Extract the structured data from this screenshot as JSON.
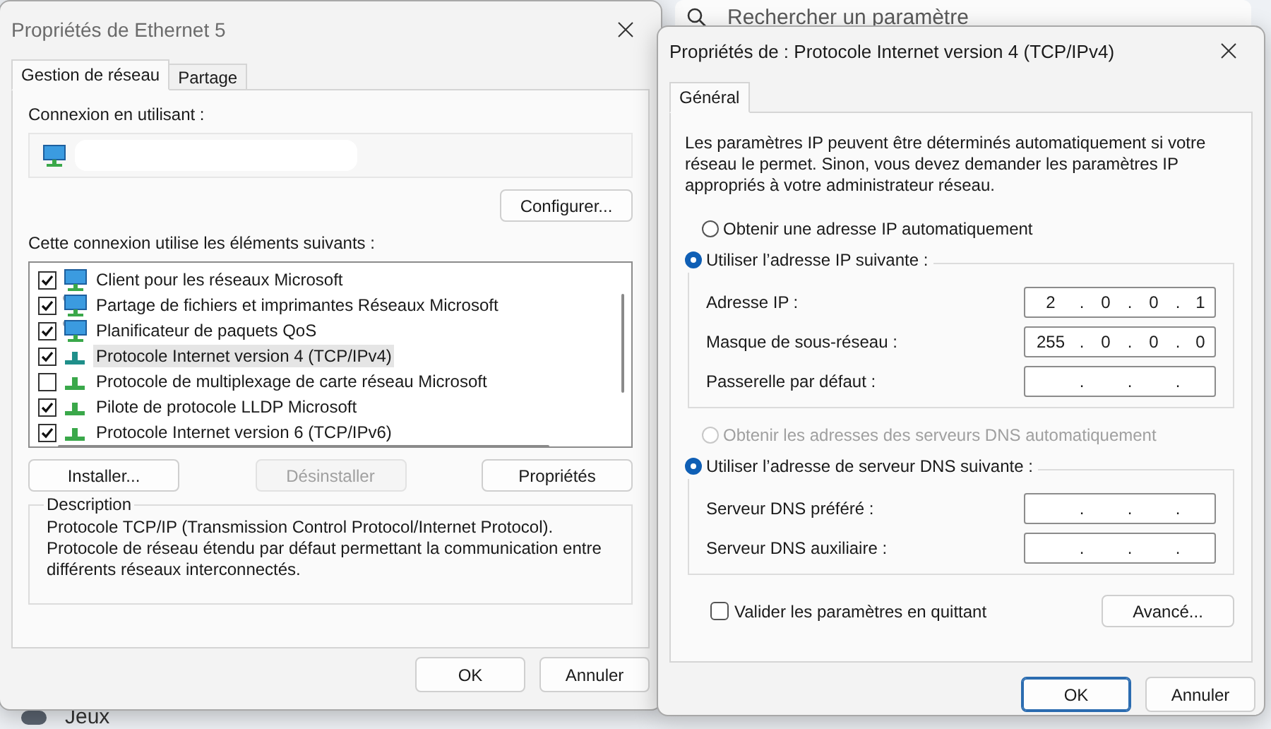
{
  "background": {
    "search": {
      "placeholder": "Rechercher un paramètre"
    },
    "nav_item": "Jeux"
  },
  "network_dialog": {
    "title": "Propriétés de Ethernet 5",
    "active": false,
    "tabs": [
      {
        "label": "Gestion de réseau",
        "selected": true
      },
      {
        "label": "Partage",
        "selected": false
      }
    ],
    "connect_using_label": "Connexion en utilisant :",
    "configure_button": "Configurer...",
    "components_label": "Cette connexion utilise les éléments suivants :",
    "components": [
      {
        "label": "Client pour les réseaux Microsoft",
        "checked": true,
        "selected": false,
        "kind": "client"
      },
      {
        "label": "Partage de fichiers et imprimantes Réseaux Microsoft",
        "checked": true,
        "selected": false,
        "kind": "service"
      },
      {
        "label": "Planificateur de paquets QoS",
        "checked": true,
        "selected": false,
        "kind": "service"
      },
      {
        "label": "Protocole Internet version 4 (TCP/IPv4)",
        "checked": true,
        "selected": true,
        "kind": "protocol"
      },
      {
        "label": "Protocole de multiplexage de carte réseau Microsoft",
        "checked": false,
        "selected": false,
        "kind": "protocol"
      },
      {
        "label": "Pilote de protocole LLDP Microsoft",
        "checked": true,
        "selected": false,
        "kind": "protocol"
      },
      {
        "label": "Protocole Internet version 6 (TCP/IPv6)",
        "checked": true,
        "selected": false,
        "kind": "protocol"
      }
    ],
    "buttons": [
      {
        "label": "Installer...",
        "disabled": false
      },
      {
        "label": "Désinstaller",
        "disabled": true
      },
      {
        "label": "Propriétés",
        "disabled": false
      }
    ],
    "description": {
      "legend": "Description",
      "text": "Protocole TCP/IP (Transmission Control Protocol/Internet Protocol). Protocole de réseau étendu par défaut permettant la communication entre différents réseaux interconnectés."
    },
    "footer_buttons": [
      {
        "label": "OK",
        "default": false
      },
      {
        "label": "Annuler",
        "default": false
      }
    ]
  },
  "ipv4_dialog": {
    "title": "Propriétés de : Protocole Internet version 4 (TCP/IPv4)",
    "active": true,
    "tabs": [
      {
        "label": "Général",
        "selected": true
      }
    ],
    "intro": "Les paramètres IP peuvent être déterminés automatiquement si votre réseau le permet. Sinon, vous devez demander les paramètres IP appropriés à votre administrateur réseau.",
    "ip_auto_radio": {
      "label": "Obtenir une adresse IP automatiquement",
      "selected": false,
      "disabled": false
    },
    "ip_manual": {
      "radio": {
        "label": "Utiliser l’adresse IP suivante :",
        "selected": true,
        "disabled": false
      },
      "fields": [
        {
          "label": "Adresse IP :",
          "parts": [
            "2",
            ".",
            "0",
            ".",
            "0",
            ".",
            "1"
          ]
        },
        {
          "label": "Masque de sous-réseau :",
          "parts": [
            "255",
            ".",
            "0",
            ".",
            "0",
            ".",
            "0"
          ]
        },
        {
          "label": "Passerelle par défaut :",
          "parts": [
            ".",
            ".",
            "."
          ]
        }
      ]
    },
    "dns_auto_radio": {
      "label": "Obtenir les adresses des serveurs DNS automatiquement",
      "selected": false,
      "disabled": true
    },
    "dns_manual": {
      "radio": {
        "label": "Utiliser l’adresse de serveur DNS suivante :",
        "selected": true,
        "disabled": false
      },
      "fields": [
        {
          "label": "Serveur DNS préféré :",
          "parts": [
            ".",
            ".",
            "."
          ]
        },
        {
          "label": "Serveur DNS auxiliaire :",
          "parts": [
            ".",
            ".",
            "."
          ]
        }
      ]
    },
    "validate_checkbox": {
      "label": "Valider les paramètres en quittant",
      "checked": false
    },
    "advanced_button": "Avancé...",
    "footer_buttons": [
      {
        "label": "OK",
        "default": true
      },
      {
        "label": "Annuler",
        "default": false
      }
    ]
  }
}
